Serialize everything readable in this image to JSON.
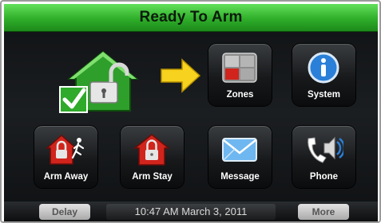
{
  "header": {
    "status": "Ready To Arm"
  },
  "tiles": {
    "zones": {
      "label": "Zones",
      "icon": "zones-grid-icon"
    },
    "system": {
      "label": "System",
      "icon": "system-info-icon"
    },
    "arm_away": {
      "label": "Arm Away",
      "icon": "arm-away-house-icon"
    },
    "arm_stay": {
      "label": "Arm Stay",
      "icon": "arm-stay-house-icon"
    },
    "message": {
      "label": "Message",
      "icon": "envelope-icon"
    },
    "phone": {
      "label": "Phone",
      "icon": "phone-speaker-icon"
    }
  },
  "status_graphic": {
    "icon": "green-house-unlocked-checkmark-icon"
  },
  "pointer": {
    "icon": "yellow-arrow-icon"
  },
  "footer": {
    "delay_label": "Delay",
    "datetime": "10:47 AM  March 3, 2011",
    "more_label": "More"
  },
  "colors": {
    "status_green": "#2fae2a",
    "arrow_yellow": "#f7d21e",
    "alarm_red": "#d0241c",
    "info_blue": "#2a7fd8"
  }
}
